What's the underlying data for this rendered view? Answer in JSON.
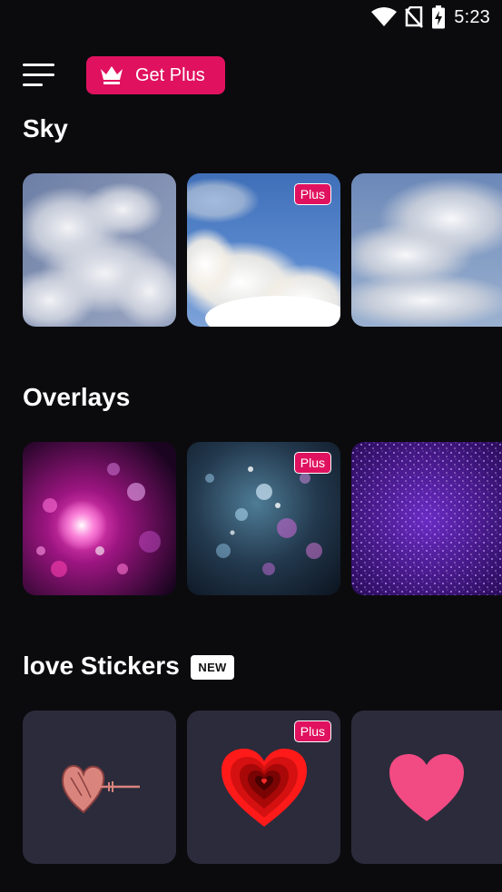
{
  "status_bar": {
    "time": "5:23",
    "icons": [
      "wifi-icon",
      "no-sim-icon",
      "battery-charging-icon"
    ]
  },
  "header": {
    "menu_icon": "hamburger-menu-icon",
    "get_plus_label": "Get Plus",
    "get_plus_icon": "crown-icon"
  },
  "sections": [
    {
      "title": "Sky",
      "items": [
        {
          "name": "clouds-dark-blue",
          "badge": ""
        },
        {
          "name": "cumulus-blue-sky",
          "badge": "Plus"
        },
        {
          "name": "clouds-horizon",
          "badge": ""
        }
      ]
    },
    {
      "title": "Overlays",
      "items": [
        {
          "name": "pink-bokeh",
          "badge": ""
        },
        {
          "name": "teal-purple-bokeh",
          "badge": "Plus"
        },
        {
          "name": "purple-glitter",
          "badge": ""
        }
      ]
    },
    {
      "title": "love Stickers",
      "badge": "NEW",
      "items": [
        {
          "name": "doodle-heart-arrow",
          "badge": ""
        },
        {
          "name": "layered-red-heart",
          "badge": "Plus"
        },
        {
          "name": "pink-heart",
          "badge": ""
        }
      ]
    }
  ],
  "colors": {
    "accent": "#e0125f",
    "background": "#0b0b0e",
    "sticker_card": "#2b2b3b"
  }
}
